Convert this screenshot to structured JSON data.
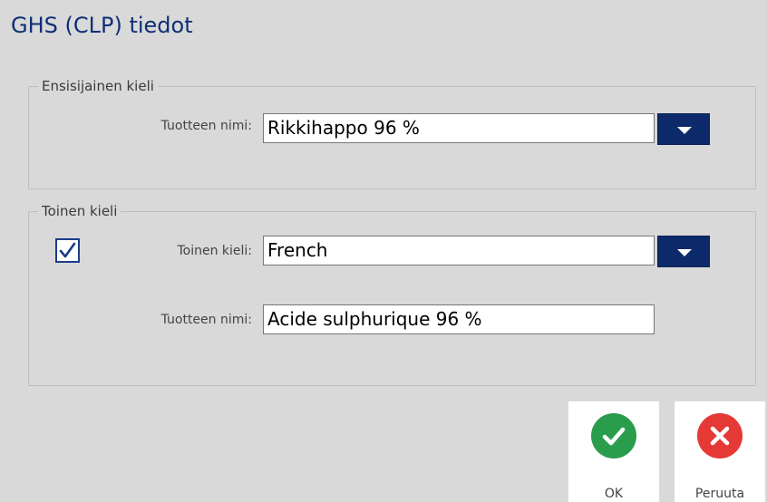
{
  "dialog": {
    "title": "GHS (CLP) tiedot"
  },
  "primary": {
    "legend": "Ensisijainen kieli",
    "product_label": "Tuotteen nimi:",
    "product_value": "Rikkihappo 96 %"
  },
  "secondary": {
    "legend": "Toinen kieli",
    "enabled": true,
    "language_label": "Toinen kieli:",
    "language_value": "French",
    "product_label": "Tuotteen nimi:",
    "product_value": "Acide sulphurique 96 %"
  },
  "buttons": {
    "ok_label": "OK",
    "cancel_label": "Peruuta"
  },
  "colors": {
    "accent": "#0d2a6b",
    "ok": "#2a9d4d",
    "cancel": "#e53935",
    "background": "#d9d9d9"
  },
  "icons": {
    "dropdown": "chevron-down-icon",
    "checkbox": "checkmark-icon",
    "ok": "check-circle-icon",
    "cancel": "close-circle-icon"
  }
}
